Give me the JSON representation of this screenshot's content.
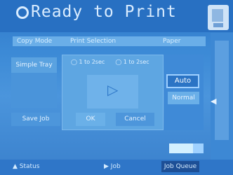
{
  "header": {
    "title": "Ready to Print",
    "status_icon": "ready-indicator-icon",
    "corner_icon": "printer-icon"
  },
  "tabs": {
    "left": "Copy Mode",
    "middle": "Print Selection",
    "right": "Paper"
  },
  "left_panel": {
    "top_button": "Simple Tray"
  },
  "center": {
    "radio_a": "1 to 2sec",
    "radio_b": "1 to 2sec",
    "preview_icon": "play-arrow-icon"
  },
  "bottom_buttons": {
    "left": "Save Job",
    "middle": "OK",
    "right": "Cancel"
  },
  "paper": {
    "selected": "Auto",
    "other": "Normal"
  },
  "progress": {
    "percent": 70
  },
  "statusbar": {
    "left": "Status",
    "middle": "Job",
    "right": "Job Queue"
  },
  "colors": {
    "screen_blue": "#2f78c8",
    "highlight": "#9fd0ff"
  }
}
